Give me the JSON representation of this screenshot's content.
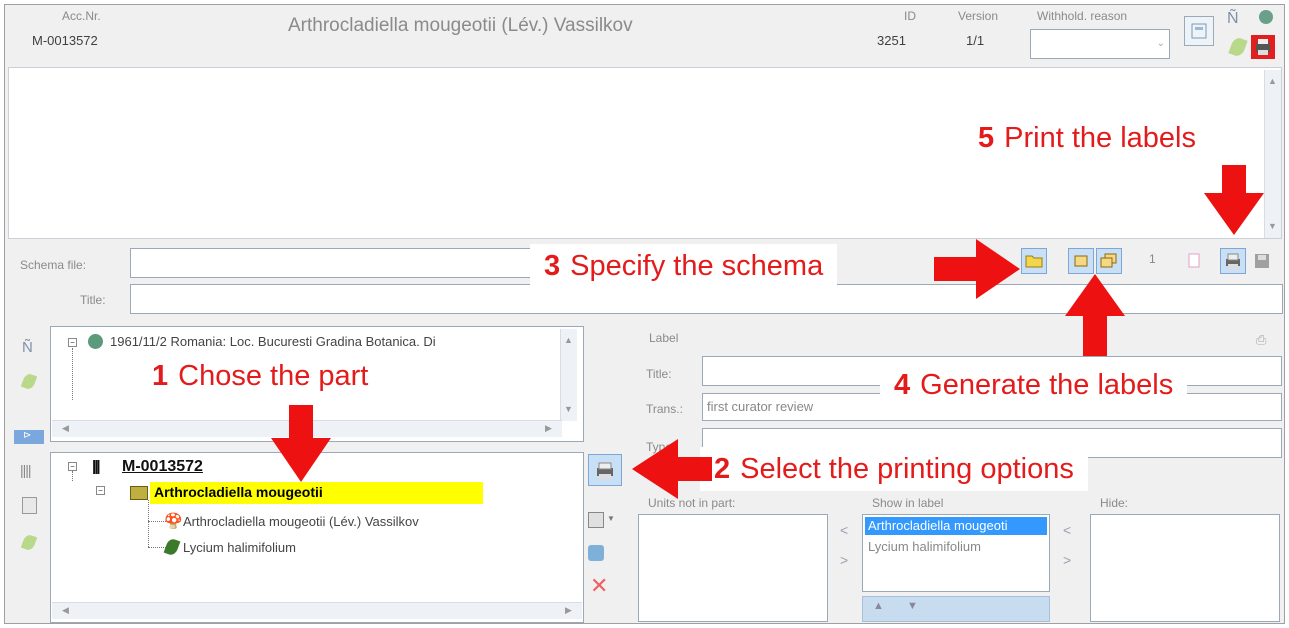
{
  "header": {
    "acc_label": "Acc.Nr.",
    "acc_value": "M-0013572",
    "title": "Arthrocladiella mougeotii (Lév.) Vassilkov",
    "id_label": "ID",
    "id_value": "3251",
    "version_label": "Version",
    "version_value": "1/1",
    "withhold_label": "Withhold. reason",
    "withhold_value": ""
  },
  "schema": {
    "schema_file_label": "Schema file:",
    "schema_file_value": "",
    "title_label": "Title:",
    "title_value": "",
    "copies_value": "1"
  },
  "upper_tree": {
    "root_text": "1961/11/2 Romania: Loc. Bucuresti Gradina Botanica. Di"
  },
  "lower_tree": {
    "root": "M-0013572",
    "part": "Arthrocladiella mougeotii",
    "children": [
      "Arthrocladiella mougeotii (Lév.) Vassilkov",
      "Lycium halimifolium"
    ]
  },
  "label_panel": {
    "group_label": "Label",
    "title_label": "Title:",
    "title_value": "",
    "trans_label": "Trans.:",
    "trans_value": "first curator review",
    "type_label": "Type:",
    "type_value": "",
    "units_not_in_part_label": "Units not in part:",
    "show_in_label_label": "Show in label",
    "hide_label": "Hide:",
    "show_in_label_items": [
      "Arthrocladiella mougeoti",
      "Lycium halimifolium"
    ]
  },
  "annotations": {
    "step1": {
      "num": "1",
      "text": "Chose the part"
    },
    "step2": {
      "num": "2",
      "text": "Select the printing options"
    },
    "step3": {
      "num": "3",
      "text": "Specify the schema"
    },
    "step4": {
      "num": "4",
      "text": "Generate the labels"
    },
    "step5": {
      "num": "5",
      "text": "Print the labels"
    }
  },
  "colors": {
    "annotation_red": "#e31b1b",
    "highlight_yellow": "#ffff00",
    "selection_blue": "#3399ff"
  }
}
